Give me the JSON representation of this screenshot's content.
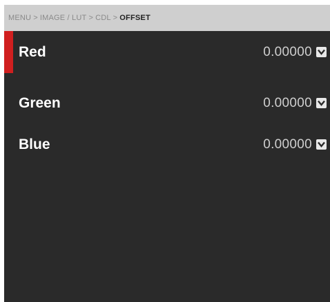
{
  "breadcrumb": {
    "items": [
      "MENU",
      "IMAGE / LUT",
      "CDL"
    ],
    "separator": ">",
    "current": "OFFSET"
  },
  "rows": [
    {
      "label": "Red",
      "value": "0.00000",
      "selected": true
    },
    {
      "label": "Green",
      "value": "0.00000",
      "selected": false
    },
    {
      "label": "Blue",
      "value": "0.00000",
      "selected": false
    }
  ],
  "colors": {
    "background": "#2a2a2a",
    "breadcrumb_bg": "#cfcfcf",
    "selection_accent": "#d01f1f",
    "label_text": "#ffffff",
    "value_text": "#cfcfcf"
  },
  "icons": {
    "dropdown": "chevron-down-icon"
  }
}
